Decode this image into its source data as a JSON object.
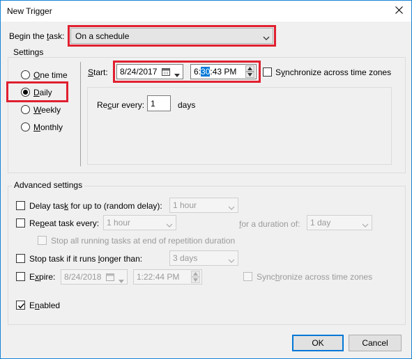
{
  "window": {
    "title": "New Trigger",
    "close_glyph": "✕"
  },
  "begin_task": {
    "label_prefix": "Begin the ",
    "label_access": "t",
    "label_suffix": "ask:",
    "value": "On a schedule"
  },
  "settings": {
    "group_title": "Settings",
    "schedule_options": [
      {
        "pre": "",
        "access": "O",
        "post": "ne time",
        "checked": false
      },
      {
        "pre": "",
        "access": "D",
        "post": "aily",
        "checked": true
      },
      {
        "pre": "",
        "access": "W",
        "post": "eekly",
        "checked": false
      },
      {
        "pre": "",
        "access": "M",
        "post": "onthly",
        "checked": false
      }
    ],
    "start": {
      "label_access": "S",
      "label_post": "tart:",
      "date": "8/24/2017",
      "time_hour": "6:",
      "time_minute_selected": "30",
      "time_rest": ":43 PM"
    },
    "sync_time_zones": {
      "pre": "S",
      "access": "y",
      "post": "nchronize across time zones",
      "checked": false
    },
    "recur": {
      "label_pre": "Re",
      "label_access": "c",
      "label_post": "ur every:",
      "value": "1",
      "unit": "days"
    }
  },
  "advanced": {
    "group_title": "Advanced settings",
    "delay": {
      "pre": "Delay tas",
      "access": "k",
      "post": " for up to (random delay):",
      "checked": false,
      "value": "1 hour"
    },
    "repeat": {
      "pre": "Re",
      "access": "p",
      "post": "eat task every:",
      "checked": false,
      "value": "1 hour",
      "duration_pre": "",
      "duration_access": "f",
      "duration_post": "or a duration of:",
      "duration_value": "1 day"
    },
    "stop_running": {
      "text": "Stop all running tasks at end of repetition duration",
      "checked": false
    },
    "stop_longer": {
      "pre": "Stop task if it runs ",
      "access": "l",
      "post": "onger than:",
      "checked": false,
      "value": "3 days"
    },
    "expire": {
      "pre": "E",
      "access": "x",
      "post": "pire:",
      "checked": false,
      "date": "8/24/2018",
      "time": "1:22:44 PM",
      "sync_pre": "Sync",
      "sync_access": "h",
      "sync_post": "ronize across time zones",
      "sync_checked": false
    },
    "enabled": {
      "pre": "E",
      "access": "n",
      "post": "abled",
      "checked": true
    }
  },
  "buttons": {
    "ok": "OK",
    "cancel": "Cancel"
  }
}
